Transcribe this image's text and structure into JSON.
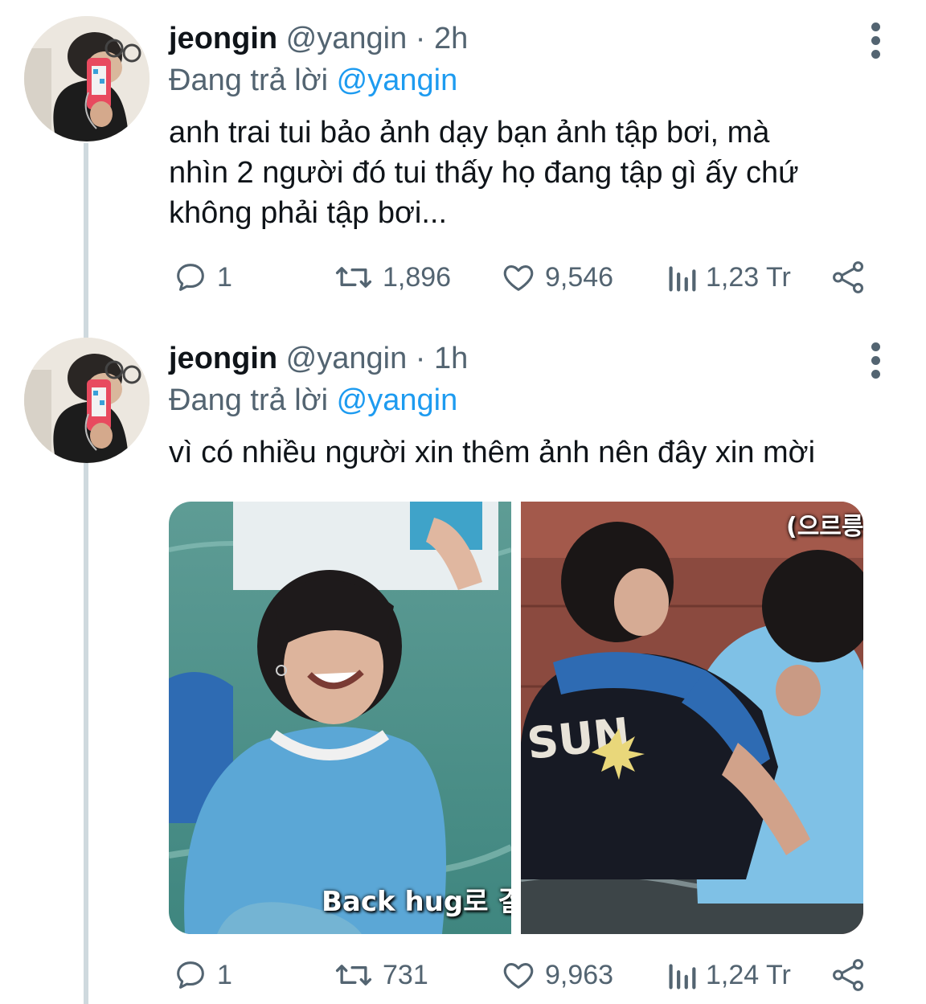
{
  "tweets": [
    {
      "name": "jeongin",
      "handle": "@yangin",
      "separator": "·",
      "time": "2h",
      "reply_prefix": "Đang trả lời",
      "reply_to": "@yangin",
      "text": "anh trai tui bảo ảnh dạy bạn ảnh tập bơi, mà\nnhìn 2 người đó tui thấy họ đang tập gì ấy chứ\nkhông phải tập bơi...",
      "replies": "1",
      "retweets": "1,896",
      "likes": "9,546",
      "views": "1,23 Tr"
    },
    {
      "name": "jeongin",
      "handle": "@yangin",
      "separator": "·",
      "time": "1h",
      "reply_prefix": "Đang trả lời",
      "reply_to": "@yangin",
      "text": "vì có nhiều người xin thêm ảnh nên đây xin mời",
      "media": {
        "left_caption": "Back hug로 결",
        "right_caption": "(으르릉"
      },
      "replies": "1",
      "retweets": "731",
      "likes": "9,963",
      "views": "1,24 Tr"
    }
  ],
  "icons": {
    "reply": "reply-bubble-icon",
    "retweet": "retweet-icon",
    "like": "heart-icon",
    "views": "views-bar-chart-icon",
    "share": "share-icon",
    "more": "more-vertical-icon"
  },
  "colors": {
    "accent": "#1d9bf0",
    "secondary_text": "#536471",
    "primary_text": "#0f1419",
    "thread_line": "#cfd9de"
  }
}
